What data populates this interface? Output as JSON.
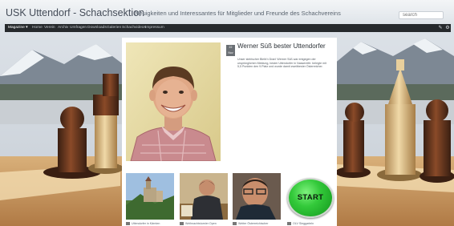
{
  "header": {
    "site_title": "USK Uttendorf - Schachsektion",
    "tagline": "Neuigkeiten und Interessantes für Mitglieder und Freunde des Schachvereins",
    "search_placeholder": "search"
  },
  "nav": {
    "items": [
      {
        "label": "Magazine ▾",
        "active": true
      },
      {
        "label": "Home"
      },
      {
        "label": "Verein"
      },
      {
        "label": "Archiv"
      },
      {
        "label": "Umfragen"
      },
      {
        "label": "Downloads"
      },
      {
        "label": "Galerien"
      },
      {
        "label": "Schachvideos"
      },
      {
        "label": "Impressum"
      }
    ],
    "right_icons": [
      "pencil-icon",
      "gear-icon"
    ]
  },
  "article": {
    "date_badge": "22 Nov",
    "title": "Werner Süß bester Uttendorfer",
    "body": "Unser steirischer Bleib'n Dran! Werner Süß war entgegen der ursprünglichen Meldung, bester Uttendorfer in Nassereith: belegte mit 5,5 Punkten den 9.Platz und wurde damit zweitbester Österreicher."
  },
  "thumbs": [
    {
      "caption": "Uttendorfer in Kärnten"
    },
    {
      "caption": "Weihnachtsturnier Open"
    },
    {
      "caption": "Weiter Österreichischer"
    },
    {
      "caption": "OLV Sieggarteln"
    }
  ],
  "start_button_label": "START",
  "colors": {
    "navbar": "#26292c",
    "start_green": "#33c93a"
  }
}
